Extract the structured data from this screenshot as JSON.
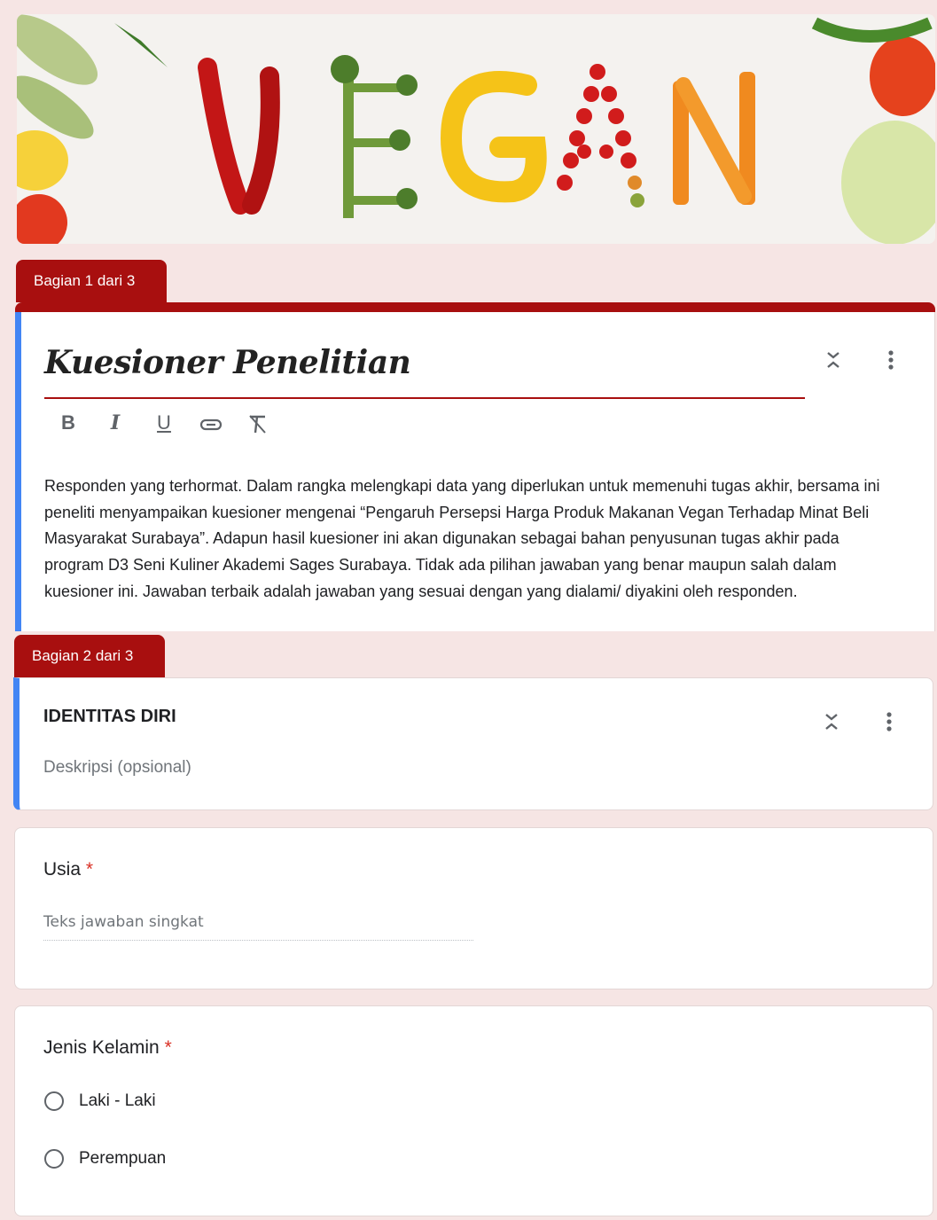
{
  "header": {
    "banner_text": "VEGAN"
  },
  "section1": {
    "tab_label": "Bagian 1 dari 3",
    "title": "Kuesioner Penelitian",
    "format_bold": "B",
    "format_italic": "I",
    "format_underline": "U",
    "format_link": "⊖",
    "format_clear": "T̸",
    "description": "Responden yang terhormat. Dalam rangka melengkapi data yang diperlukan untuk memenuhi tugas akhir, bersama ini peneliti menyampaikan kuesioner mengenai “Pengaruh Persepsi Harga Produk Makanan Vegan Terhadap Minat Beli Masyarakat Surabaya”. Adapun hasil kuesioner ini akan digunakan sebagai bahan penyusunan tugas akhir pada program D3 Seni Kuliner Akademi Sages Surabaya. Tidak ada pilihan jawaban yang benar maupun salah dalam kuesioner ini. Jawaban terbaik adalah jawaban yang sesuai dengan yang dialami/ diyakini oleh responden."
  },
  "section2": {
    "tab_label": "Bagian 2 dari 3",
    "title": "IDENTITAS DIRI",
    "description_placeholder": "Deskripsi (opsional)"
  },
  "questions": [
    {
      "title": "Usia",
      "required_mark": "*",
      "answer_placeholder": "Teks jawaban singkat"
    },
    {
      "title": "Jenis Kelamin",
      "required_mark": "*",
      "options": [
        "Laki - Laki",
        "Perempuan"
      ]
    }
  ],
  "colors": {
    "accent": "#a80f0f",
    "left_border": "#4285f4",
    "background": "#f6e5e4"
  },
  "icons": {
    "collapse": "collapse-icon",
    "more": "more-vert-icon"
  }
}
